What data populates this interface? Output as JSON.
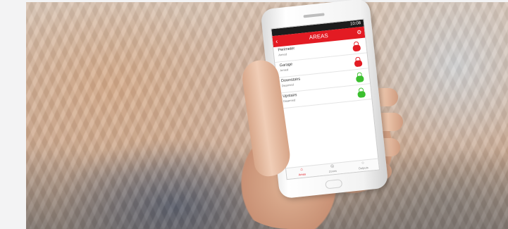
{
  "phone_app": {
    "status_time": "10:08",
    "title": "AREAS",
    "areas": [
      {
        "name": "Perimeter",
        "status": "Armed",
        "lock_state": "locked",
        "lock_color": "#e31b23"
      },
      {
        "name": "Garage",
        "status": "Armed",
        "lock_state": "locked",
        "lock_color": "#e31b23"
      },
      {
        "name": "Downstairs",
        "status": "Disarmed",
        "lock_state": "unlocked",
        "lock_color": "#3bbf2e"
      },
      {
        "name": "Upstairs",
        "status": "Disarmed",
        "lock_state": "unlocked",
        "lock_color": "#3bbf2e"
      }
    ],
    "nav": [
      {
        "label": "Areas",
        "icon": "home-icon"
      },
      {
        "label": "Zones",
        "icon": "target-icon"
      },
      {
        "label": "Outputs",
        "icon": "plug-icon"
      }
    ],
    "accent_color": "#e31b23"
  }
}
